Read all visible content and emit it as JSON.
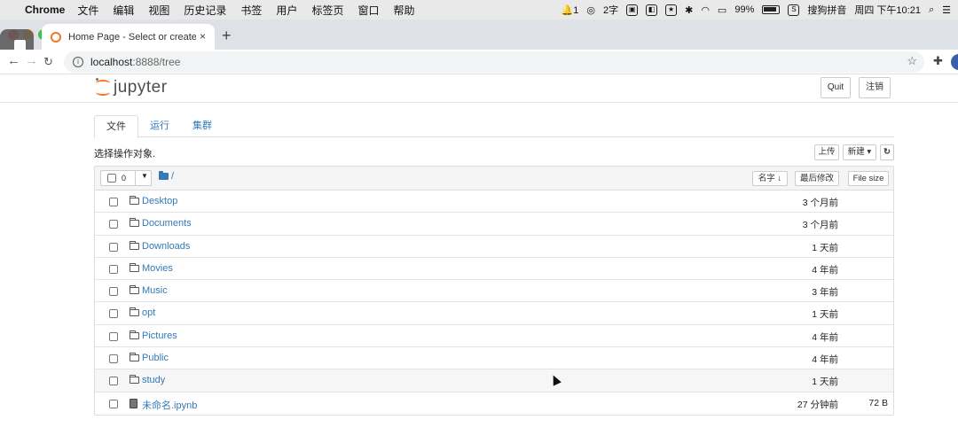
{
  "menubar": {
    "app_name": "Chrome",
    "items": [
      "文件",
      "编辑",
      "视图",
      "历史记录",
      "书签",
      "用户",
      "标签页",
      "窗口",
      "帮助"
    ],
    "status": {
      "notification_count": "1",
      "ime_chars": "2字",
      "battery_percent": "99%",
      "input_method": "搜狗拼音",
      "clock": "周四 下午10:21"
    }
  },
  "browser": {
    "tab_title": "Home Page - Select or create a notebook",
    "tab_close": "×",
    "new_tab": "+",
    "url_host": "localhost",
    "url_path": ":8888/tree",
    "info_icon": "i"
  },
  "jupyter": {
    "logo_text": "jupyter",
    "quit_label": "Quit",
    "logout_label": "注销",
    "tabs": [
      {
        "label": "文件"
      },
      {
        "label": "运行"
      },
      {
        "label": "集群"
      }
    ],
    "select_prompt": "选择操作对象.",
    "upload_label": "上传",
    "new_label": "新建 ▾",
    "refresh_icon": "↻",
    "selected_count": "0",
    "breadcrumb_path": "/",
    "sort": {
      "name_label": "名字 ↓",
      "modified_label": "最后修改",
      "size_label": "File size"
    },
    "files": [
      {
        "name": "Desktop",
        "type": "folder",
        "modified": "3 个月前",
        "size": ""
      },
      {
        "name": "Documents",
        "type": "folder",
        "modified": "3 个月前",
        "size": ""
      },
      {
        "name": "Downloads",
        "type": "folder",
        "modified": "1 天前",
        "size": ""
      },
      {
        "name": "Movies",
        "type": "folder",
        "modified": "4 年前",
        "size": ""
      },
      {
        "name": "Music",
        "type": "folder",
        "modified": "3 年前",
        "size": ""
      },
      {
        "name": "opt",
        "type": "folder",
        "modified": "1 天前",
        "size": ""
      },
      {
        "name": "Pictures",
        "type": "folder",
        "modified": "4 年前",
        "size": ""
      },
      {
        "name": "Public",
        "type": "folder",
        "modified": "4 年前",
        "size": ""
      },
      {
        "name": "study",
        "type": "folder",
        "modified": "1 天前",
        "size": ""
      },
      {
        "name": "未命名.ipynb",
        "type": "notebook",
        "modified": "27 分钟前",
        "size": "72 B"
      }
    ]
  },
  "colors": {
    "link": "#337ab7",
    "jupyter_orange": "#f37726",
    "header_bg": "#f5f5f5"
  }
}
